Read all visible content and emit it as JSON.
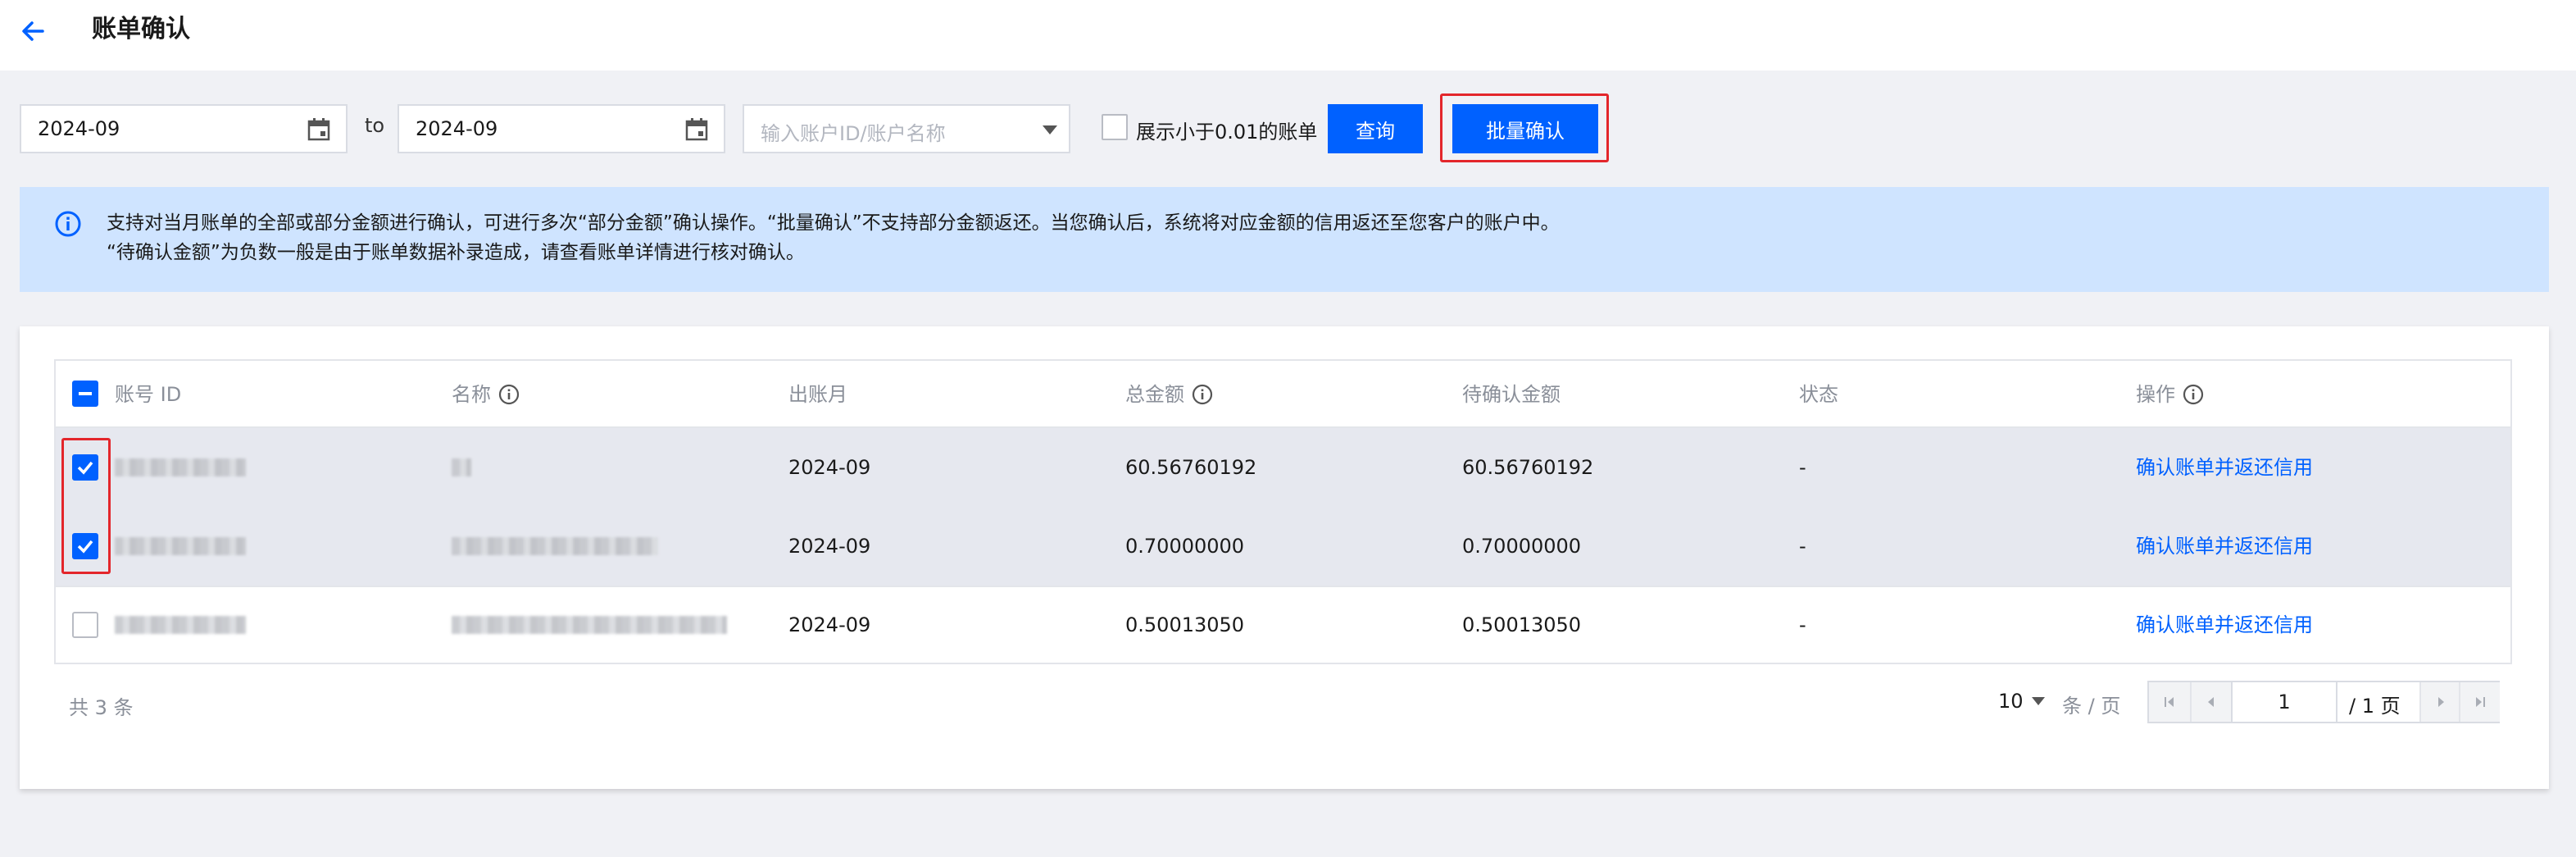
{
  "header": {
    "title": "账单确认"
  },
  "toolbar": {
    "start_date": "2024-09",
    "to_label": "to",
    "end_date": "2024-09",
    "account_placeholder": "输入账户ID/账户名称",
    "small_bills_label": "展示小于0.01的账单",
    "query_label": "查询",
    "batch_confirm_label": "批量确认"
  },
  "notice": {
    "line1": "支持对当月账单的全部或部分金额进行确认，可进行多次“部分金额”确认操作。“批量确认”不支持部分金额返还。当您确认后，系统将对应金额的信用返还至您客户的账户中。",
    "line2": "“待确认金额”为负数一般是由于账单数据补录造成，请查看账单详情进行核对确认。"
  },
  "table": {
    "headers": {
      "account_id": "账号 ID",
      "name": "名称",
      "month": "出账月",
      "total": "总金额",
      "pending": "待确认金额",
      "status": "状态",
      "action": "操作"
    },
    "rows": [
      {
        "selected": true,
        "month": "2024-09",
        "total": "60.56760192",
        "pending": "60.56760192",
        "status": "-",
        "action": "确认账单并返还信用"
      },
      {
        "selected": true,
        "month": "2024-09",
        "total": "0.70000000",
        "pending": "0.70000000",
        "status": "-",
        "action": "确认账单并返还信用"
      },
      {
        "selected": false,
        "month": "2024-09",
        "total": "0.50013050",
        "pending": "0.50013050",
        "status": "-",
        "action": "确认账单并返还信用"
      }
    ]
  },
  "footer": {
    "total_label": "共 3 条",
    "page_size": "10",
    "per_page_label": "条 / 页",
    "current_page": "1",
    "total_pages_label": "/ 1 页"
  },
  "colors": {
    "primary": "#0061ff",
    "highlight": "#e3262b",
    "notice_bg": "#cfe4ff"
  }
}
